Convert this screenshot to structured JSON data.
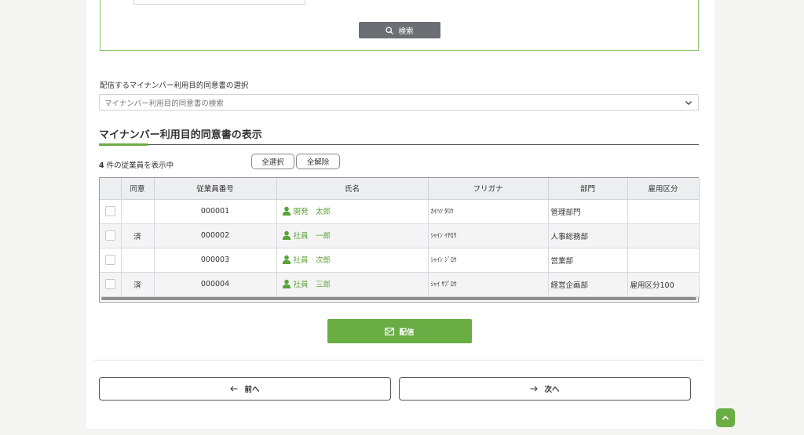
{
  "search": {
    "button_label": "検索"
  },
  "consent_select": {
    "label": "配信するマイナンバー利用目的同意書の選択",
    "placeholder": "マイナンバー利用目的同意書の検索"
  },
  "section": {
    "title": "マイナンバー利用目的同意書の表示"
  },
  "list_summary": {
    "count": "4",
    "suffix": "件の従業員を表示中"
  },
  "bulk_actions": {
    "select_all": "全選択",
    "deselect_all": "全解除"
  },
  "table": {
    "headers": [
      "",
      "同意",
      "従業員番号",
      "氏名",
      "フリガナ",
      "部門",
      "雇用区分"
    ],
    "rows": [
      {
        "consent": "",
        "employee_no": "000001",
        "name": "開発　太郎",
        "furigana": "ｶｲﾊﾂ ﾀﾛｳ",
        "department": "管理部門",
        "employment_type": ""
      },
      {
        "consent": "済",
        "employee_no": "000002",
        "name": "社員　一郎",
        "furigana": "ｼｬｲﾝ ｲﾁﾛｳ",
        "department": "人事総務部",
        "employment_type": ""
      },
      {
        "consent": "",
        "employee_no": "000003",
        "name": "社員　次郎",
        "furigana": "ｼｬｲﾝ ｼﾞﾛｳ",
        "department": "営業部",
        "employment_type": ""
      },
      {
        "consent": "済",
        "employee_no": "000004",
        "name": "社員　三郎",
        "furigana": "ｼｬｲ ｻﾌﾞﾛｳ",
        "department": "経営企画部",
        "employment_type": "雇用区分100"
      }
    ]
  },
  "actions": {
    "send_label": "配信",
    "prev_label": "前へ",
    "next_label": "次へ"
  },
  "icons": {
    "search": "search-icon",
    "send": "mail-icon",
    "user": "user-icon",
    "chevron": "chevron-down-icon",
    "to_top": "chevron-up-icon"
  },
  "colors": {
    "accent": "#6aad45",
    "search_button": "#6b6e73",
    "link": "#5aa33a"
  }
}
